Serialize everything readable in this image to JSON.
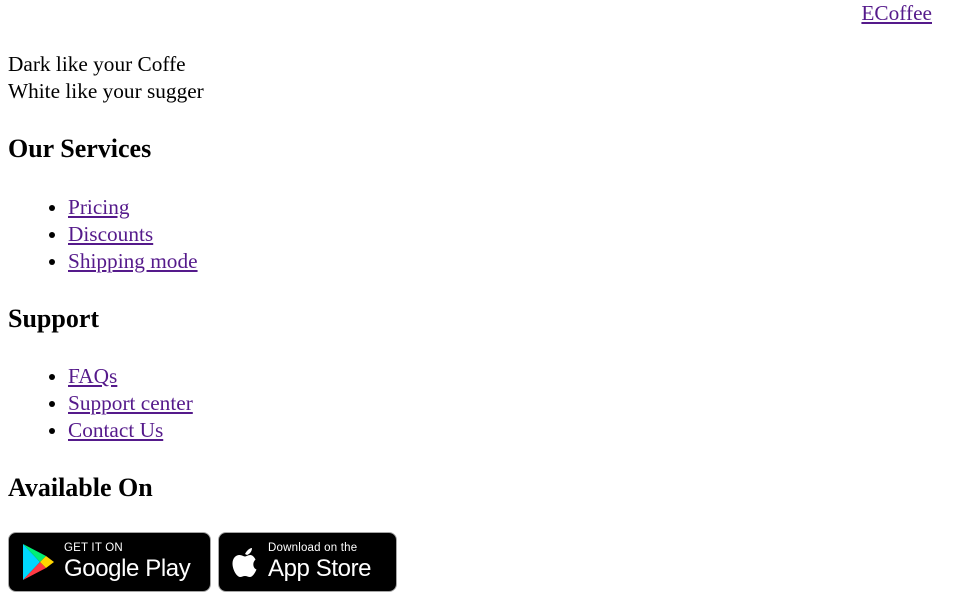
{
  "header": {
    "brand_link": " ECoffee"
  },
  "tagline": {
    "line1": "Dark like your Coffe",
    "line2": "White like your sugger"
  },
  "services": {
    "heading": "Our Services",
    "items": [
      {
        "label": "Pricing"
      },
      {
        "label": "Discounts"
      },
      {
        "label": "Shipping mode"
      }
    ]
  },
  "support": {
    "heading": "Support",
    "items": [
      {
        "label": "FAQs"
      },
      {
        "label": "Support center"
      },
      {
        "label": "Contact Us"
      }
    ]
  },
  "available": {
    "heading": "Available On",
    "google_play": {
      "icon": "google-play-icon",
      "small": "GET IT ON",
      "big": "Google Play"
    },
    "app_store": {
      "icon": "apple-icon",
      "small": "Download on the",
      "big": "App Store"
    }
  },
  "colors": {
    "link": "#551a8b",
    "badge_bg": "#000000",
    "badge_border": "#a6a6a6"
  }
}
